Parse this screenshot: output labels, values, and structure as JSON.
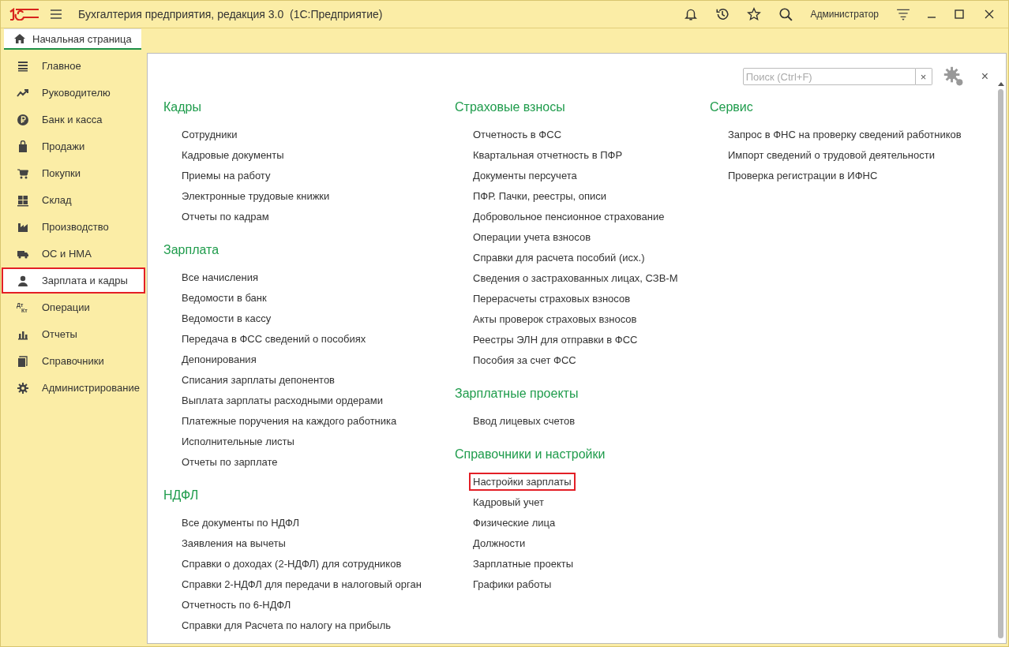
{
  "window": {
    "title": "Бухгалтерия предприятия, редакция 3.0  (1С:Предприятие)",
    "user": "Администратор"
  },
  "tabs": [
    {
      "label": "Начальная страница",
      "selected": true
    }
  ],
  "sidebar": {
    "items": [
      {
        "label": "Главное",
        "kind": "lines",
        "selected": false
      },
      {
        "label": "Руководителю",
        "kind": "trend",
        "selected": false
      },
      {
        "label": "Банк и касса",
        "kind": "ruble",
        "selected": false
      },
      {
        "label": "Продажи",
        "kind": "bag",
        "selected": false
      },
      {
        "label": "Покупки",
        "kind": "cart",
        "selected": false
      },
      {
        "label": "Склад",
        "kind": "grid",
        "selected": false
      },
      {
        "label": "Производство",
        "kind": "factory",
        "selected": false
      },
      {
        "label": "ОС и НМА",
        "kind": "truck",
        "selected": false
      },
      {
        "label": "Зарплата и кадры",
        "kind": "person",
        "selected": true
      },
      {
        "label": "Операции",
        "kind": "dtkt",
        "icon_top": "Дт",
        "icon_bottom": "Кт",
        "selected": false
      },
      {
        "label": "Отчеты",
        "kind": "bars",
        "selected": false
      },
      {
        "label": "Справочники",
        "kind": "books",
        "selected": false
      },
      {
        "label": "Администрирование",
        "kind": "gear",
        "selected": false
      }
    ]
  },
  "search": {
    "placeholder": "Поиск (Ctrl+F)",
    "clear": "×"
  },
  "close": "×",
  "columns": [
    [
      {
        "title": "Кадры",
        "links": [
          {
            "label": "Сотрудники",
            "highlighted": false
          },
          {
            "label": "Кадровые документы",
            "highlighted": false
          },
          {
            "label": "Приемы на работу",
            "highlighted": false
          },
          {
            "label": "Электронные трудовые книжки",
            "highlighted": false
          },
          {
            "label": "Отчеты по кадрам",
            "highlighted": false
          }
        ]
      },
      {
        "title": "Зарплата",
        "links": [
          {
            "label": "Все начисления",
            "highlighted": false
          },
          {
            "label": "Ведомости в банк",
            "highlighted": false
          },
          {
            "label": "Ведомости в кассу",
            "highlighted": false
          },
          {
            "label": "Передача в ФСС сведений о пособиях",
            "highlighted": false
          },
          {
            "label": "Депонирования",
            "highlighted": false
          },
          {
            "label": "Списания зарплаты депонентов",
            "highlighted": false
          },
          {
            "label": "Выплата зарплаты расходными ордерами",
            "highlighted": false
          },
          {
            "label": "Платежные поручения на каждого работника",
            "highlighted": false
          },
          {
            "label": "Исполнительные листы",
            "highlighted": false
          },
          {
            "label": "Отчеты по зарплате",
            "highlighted": false
          }
        ]
      },
      {
        "title": "НДФЛ",
        "links": [
          {
            "label": "Все документы по НДФЛ",
            "highlighted": false
          },
          {
            "label": "Заявления на вычеты",
            "highlighted": false
          },
          {
            "label": "Справки о доходах (2-НДФЛ) для сотрудников",
            "highlighted": false
          },
          {
            "label": "Справки 2-НДФЛ для передачи в налоговый орган",
            "highlighted": false
          },
          {
            "label": "Отчетность по 6-НДФЛ",
            "highlighted": false
          },
          {
            "label": "Справки для Расчета по налогу на прибыль",
            "highlighted": false
          }
        ]
      }
    ],
    [
      {
        "title": "Страховые взносы",
        "links": [
          {
            "label": "Отчетность в ФСС",
            "highlighted": false
          },
          {
            "label": "Квартальная отчетность в ПФР",
            "highlighted": false
          },
          {
            "label": "Документы персучета",
            "highlighted": false
          },
          {
            "label": "ПФР. Пачки, реестры, описи",
            "highlighted": false
          },
          {
            "label": "Добровольное пенсионное страхование",
            "highlighted": false
          },
          {
            "label": "Операции учета взносов",
            "highlighted": false
          },
          {
            "label": "Справки для расчета пособий (исх.)",
            "highlighted": false
          },
          {
            "label": "Сведения о застрахованных лицах, СЗВ-М",
            "highlighted": false
          },
          {
            "label": "Перерасчеты страховых взносов",
            "highlighted": false
          },
          {
            "label": "Акты проверок страховых взносов",
            "highlighted": false
          },
          {
            "label": "Реестры ЭЛН для отправки в ФСС",
            "highlighted": false
          },
          {
            "label": "Пособия за счет ФСС",
            "highlighted": false
          }
        ]
      },
      {
        "title": "Зарплатные проекты",
        "links": [
          {
            "label": "Ввод лицевых счетов",
            "highlighted": false
          }
        ]
      },
      {
        "title": "Справочники и настройки",
        "links": [
          {
            "label": "Настройки зарплаты",
            "highlighted": true
          },
          {
            "label": "Кадровый учет",
            "highlighted": false
          },
          {
            "label": "Физические лица",
            "highlighted": false
          },
          {
            "label": "Должности",
            "highlighted": false
          },
          {
            "label": "Зарплатные проекты",
            "highlighted": false
          },
          {
            "label": "Графики работы",
            "highlighted": false
          }
        ]
      }
    ],
    [
      {
        "title": "Сервис",
        "links": [
          {
            "label": "Запрос в ФНС на проверку сведений работников",
            "highlighted": false
          },
          {
            "label": "Импорт сведений о трудовой деятельности",
            "highlighted": false
          },
          {
            "label": "Проверка регистрации в ИФНС",
            "highlighted": false
          }
        ]
      }
    ]
  ]
}
